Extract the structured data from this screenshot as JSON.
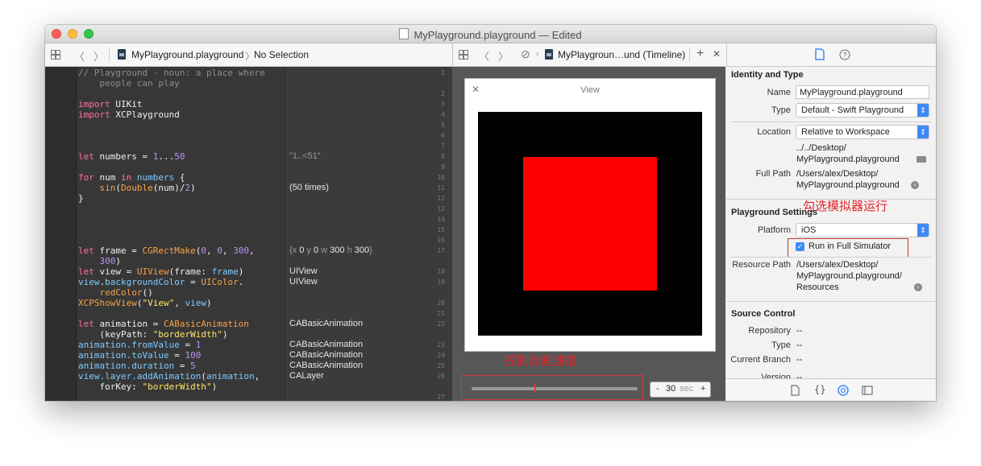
{
  "window": {
    "title": "MyPlayground.playground — Edited"
  },
  "left_jumpbar": {
    "file": "MyPlayground.playground",
    "separator": "〉",
    "selection": "No Selection"
  },
  "mid_jumpbar": {
    "file": "MyPlaygroun…und (Timeline)",
    "add": "+",
    "close": "✕"
  },
  "editor": {
    "line_numbers": [
      "1",
      "2",
      "3",
      "4",
      "5",
      "6",
      "7",
      "8",
      "9",
      "10",
      "11",
      "12",
      "13",
      "14",
      "15",
      "16",
      "17",
      "18",
      "19",
      "20",
      "21",
      "22",
      "23",
      "24",
      "25",
      "26",
      "27"
    ],
    "lines": {
      "l1a": "// Playground - noun: a place where",
      "l1b": "    people can play",
      "l3_kw": "import",
      "l3": " UIKit",
      "l4_kw": "import",
      "l4": " XCPlayground",
      "l8_kw": "let",
      "l8_a": " numbers = ",
      "l8_n1": "1",
      "l8_op": "...",
      "l8_n2": "50",
      "l10_kw": "for",
      "l10_a": " num ",
      "l10_in": "in",
      "l10_b": " numbers",
      "l10_c": " {",
      "l11_fn": "    sin",
      "l11_a": "(",
      "l11_ty": "Double",
      "l11_b": "(num)/",
      "l11_n": "2",
      "l11_c": ")",
      "l12": "}",
      "l17_kw": "let",
      "l17_a": " frame = ",
      "l17_fn": "CGRectMake",
      "l17_b": "(",
      "l17_n1": "0",
      "l17_c": ", ",
      "l17_n2": "0",
      "l17_d": ", ",
      "l17_n3": "300",
      "l17_e": ",",
      "l17_2_n": "    300",
      "l17_2_b": ")",
      "l18_kw": "let",
      "l18_a": " view = ",
      "l18_ty": "UIView",
      "l18_b": "(frame: ",
      "l18_c": "frame",
      "l18_d": ")",
      "l19_a": "view",
      "l19_b": ".",
      "l19_c": "backgroundColor",
      "l19_d": " = ",
      "l19_ty": "UIColor",
      "l19_e": ".",
      "l19_2": "    redColor",
      "l19_2b": "()",
      "l20_fn": "XCPShowView",
      "l20_a": "(",
      "l20_s": "\"View\"",
      "l20_b": ", ",
      "l20_c": "view",
      "l20_d": ")",
      "l22_kw": "let",
      "l22_a": " animation = ",
      "l22_ty": "CABasicAnimation",
      "l22_2a": "    (keyPath: ",
      "l22_2s": "\"borderWidth\"",
      "l22_2b": ")",
      "l23_a": "animation",
      "l23_b": ".fromValue",
      "l23_c": " = ",
      "l23_n": "1",
      "l24_a": "animation",
      "l24_b": ".toValue",
      "l24_c": " = ",
      "l24_n": "100",
      "l25_a": "animation",
      "l25_b": ".duration",
      "l25_c": " = ",
      "l25_n": "5",
      "l26_a": "view",
      "l26_b": ".layer",
      "l26_c": ".addAnimation",
      "l26_d": "(",
      "l26_e": "animation",
      "l26_f": ",",
      "l26_2a": "    forKey: ",
      "l26_2s": "\"borderWidth\"",
      "l26_2b": ")"
    },
    "results": {
      "r8": "\"1..<51\"",
      "r11": "(50 times)",
      "r17_a": "{x ",
      "r17_b": "0",
      "r17_c": " y ",
      "r17_d": "0",
      "r17_e": " w ",
      "r17_f": "300",
      "r17_g": " h ",
      "r17_h": "300",
      "r17_i": "}",
      "r18": "UIView",
      "r19": "UIView",
      "r22": "CABasicAnimation",
      "r23": "CABasicAnimation",
      "r24": "CABasicAnimation",
      "r25": "CABasicAnimation",
      "r26": "CALayer"
    }
  },
  "timeline": {
    "view_title": "View",
    "close": "✕",
    "annotation": "控制动画速度",
    "slider_position": 0.38,
    "stepper": {
      "minus": "-",
      "value": "30",
      "unit": "sec",
      "plus": "+"
    }
  },
  "inspector": {
    "identity": {
      "heading": "Identity and Type",
      "name_label": "Name",
      "name_value": "MyPlayground.playground",
      "type_label": "Type",
      "type_value": "Default - Swift Playground",
      "location_label": "Location",
      "location_value": "Relative to Workspace",
      "path_1": "../../Desktop/",
      "path_2": "MyPlayground.playground",
      "fullpath_label": "Full Path",
      "fullpath_1": "/Users/alex/Desktop/",
      "fullpath_2": "MyPlayground.playground"
    },
    "annotation": "勾选模拟器运行",
    "playground": {
      "heading": "Playground Settings",
      "platform_label": "Platform",
      "platform_value": "iOS",
      "simulator_label": "Run in Full Simulator",
      "simulator_checked": true,
      "resource_label": "Resource Path",
      "resource_1": "/Users/alex/Desktop/",
      "resource_2": "MyPlayground.playground/",
      "resource_3": "Resources"
    },
    "source_control": {
      "heading": "Source Control",
      "repository_label": "Repository",
      "repository_value": "--",
      "type_label": "Type",
      "type_value": "--",
      "branch_label": "Current Branch",
      "branch_value": "--",
      "version_label": "Version",
      "version_value": "--"
    }
  },
  "colors": {
    "accent": "#3d8af7",
    "annotation": "#e3242b",
    "view_red": "#ff0000"
  }
}
